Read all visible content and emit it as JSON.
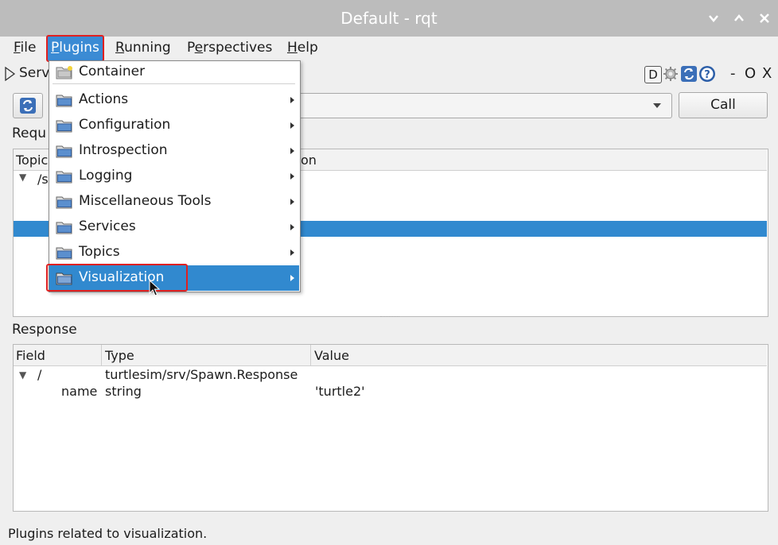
{
  "window": {
    "title": "Default - rqt",
    "controls": [
      "chevron-down-icon",
      "chevron-up-icon",
      "close-icon"
    ]
  },
  "menubar": {
    "items": [
      {
        "label": "File",
        "underline": "F"
      },
      {
        "label": "Plugins",
        "underline": "P",
        "active": true
      },
      {
        "label": "Running",
        "underline": "R"
      },
      {
        "label": "Perspectives",
        "underline": "e"
      },
      {
        "label": "Help",
        "underline": "H"
      }
    ]
  },
  "plugin": {
    "title_partial": "Serv",
    "header_buttons": [
      "D",
      "gear-icon",
      "refresh-icon",
      "help-icon"
    ],
    "minimize_label": "-",
    "float_label": "O",
    "close_label": "X"
  },
  "toolbar": {
    "call_label": "Call"
  },
  "request": {
    "label_partial": "Requ",
    "columns": [
      "Topic",
      "on"
    ],
    "tree_label_partial": "/s"
  },
  "response": {
    "label": "Response",
    "columns": [
      "Field",
      "Type",
      "Value"
    ],
    "rows": [
      {
        "field": "/",
        "type": "turtlesim/srv/Spawn.Response",
        "value": ""
      },
      {
        "field": "name",
        "type": "string",
        "value": "'turtle2'"
      }
    ]
  },
  "dropdown": {
    "items": [
      {
        "label": "Container",
        "submenu": false,
        "icon": "container-folder-icon"
      },
      {
        "label": "Actions",
        "submenu": true,
        "icon": "folder-icon"
      },
      {
        "label": "Configuration",
        "submenu": true,
        "icon": "folder-icon"
      },
      {
        "label": "Introspection",
        "submenu": true,
        "icon": "folder-icon"
      },
      {
        "label": "Logging",
        "submenu": true,
        "icon": "folder-icon"
      },
      {
        "label": "Miscellaneous Tools",
        "submenu": true,
        "icon": "folder-icon"
      },
      {
        "label": "Services",
        "submenu": true,
        "icon": "folder-icon"
      },
      {
        "label": "Topics",
        "submenu": true,
        "icon": "folder-icon"
      },
      {
        "label": "Visualization",
        "submenu": true,
        "icon": "folder-icon",
        "highlighted": true
      }
    ]
  },
  "statusbar": {
    "text": "Plugins related to visualization."
  },
  "colors": {
    "selection": "#3189cf",
    "annotation_box": "#e02020",
    "titlebar": "#bcbcbc"
  }
}
